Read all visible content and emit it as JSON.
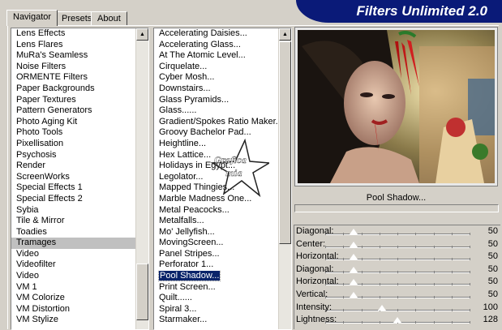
{
  "tabs": [
    {
      "label": "Navigator",
      "active": true
    },
    {
      "label": "Presets",
      "active": false
    },
    {
      "label": "About",
      "active": false
    }
  ],
  "title": "Filters Unlimited 2.0",
  "categories": [
    "Lens Effects",
    "Lens Flares",
    "MuRa's Seamless",
    "Noise Filters",
    "ORMENTE Filters",
    "Paper Backgrounds",
    "Paper Textures",
    "Pattern Generators",
    "Photo Aging Kit",
    "Photo Tools",
    "Pixellisation",
    "Psychosis",
    "Render",
    "ScreenWorks",
    "Special Effects 1",
    "Special Effects 2",
    "Sybia",
    "Tile & Mirror",
    "Toadies",
    "Tramages",
    "Video",
    "Videofilter",
    "Video",
    "VM 1",
    "VM Colorize",
    "VM Distortion",
    "VM Stylize"
  ],
  "selected_category": "Tramages",
  "filters": [
    "Accelerating Daisies...",
    "Accelerating Glass...",
    "At The Atomic Level...",
    "Cirquelate...",
    "Cyber Mosh...",
    "Downstairs...",
    "Glass Pyramids...",
    "Glass......",
    "Gradient/Spokes Ratio Maker...",
    "Groovy Bachelor Pad...",
    "Heightline...",
    "Hex Lattice...",
    "Holidays in Egypt...",
    "Legolator...",
    "Mapped Thingies...",
    "Marble Madness One...",
    "Metal Peacocks...",
    "Metalfalls...",
    "Mo' Jellyfish...",
    "MovingScreen...",
    "Panel Stripes...",
    "Perforator 1...",
    "Pool Shadow...",
    "Print Screen...",
    "Quilt......",
    "Spiral 3...",
    "Starmaker..."
  ],
  "selected_filter": "Pool Shadow...",
  "preview_label": "Pool Shadow...",
  "watermark": "Grafica mia",
  "params": [
    {
      "label": "Diagonal:",
      "value": "50",
      "level": 0.196
    },
    {
      "label": "Center:",
      "value": "50",
      "level": 0.196
    },
    {
      "label": "Horizontal:",
      "value": "50",
      "level": 0.196
    },
    {
      "label": "Diagonal:",
      "value": "50",
      "level": 0.196
    },
    {
      "label": "Horizontal:",
      "value": "50",
      "level": 0.196
    },
    {
      "label": "Vertical:",
      "value": "50",
      "level": 0.196
    },
    {
      "label": "Intensity:",
      "value": "100",
      "level": 0.392
    },
    {
      "label": "Lightness:",
      "value": "128",
      "level": 0.502
    }
  ],
  "colors": {
    "title_bg": "#0a1a78",
    "selection": "#0a246a",
    "dialog_bg": "#d4d0c8"
  }
}
